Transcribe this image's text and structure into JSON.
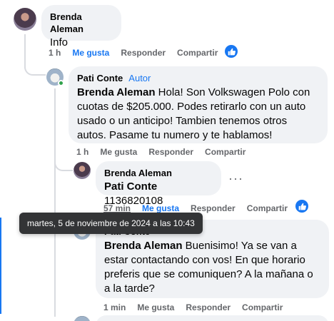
{
  "comments": [
    {
      "author": "Brenda Aleman",
      "text": "Info",
      "time": "1 h",
      "like": "Me gusta",
      "reply": "Responder",
      "share": "Compartir"
    },
    {
      "author": "Pati Conte",
      "badge": "Autor",
      "mention": "Brenda Aleman",
      "text": "Hola! Son Volkswagen Polo con cuotas de $205.000. Podes retirarlo con un auto usado o un anticipo! Tambien tenemos otros autos. Pasame tu numero y te hablamos!",
      "time": "1 h",
      "like": "Me gusta",
      "reply": "Responder",
      "share": "Compartir"
    },
    {
      "author": "Brenda Aleman",
      "mention": "Pati Conte",
      "text": "1136820108",
      "time": "57 min",
      "like": "Me gusta",
      "reply": "Responder",
      "share": "Compartir"
    },
    {
      "author": "Pati Conte",
      "mention": "Brenda Aleman",
      "text": "Buenisimo! Ya se van a estar contactando con vos! En que horario preferis que se comuniquen? A la mañana o a la tarde?",
      "time": "1 min",
      "like": "Me gusta",
      "reply": "Responder",
      "share": "Compartir"
    }
  ],
  "more_options": "···",
  "tooltip": "martes, 5 de noviembre de 2024 a las 10:43",
  "colors": {
    "accent": "#1877f2",
    "bubble": "#f0f2f5",
    "muted": "#65676b",
    "tooltip_bg": "#333436"
  },
  "icons": {
    "reaction": "like-icon",
    "menu": "more-options-icon",
    "online": "online-indicator"
  }
}
